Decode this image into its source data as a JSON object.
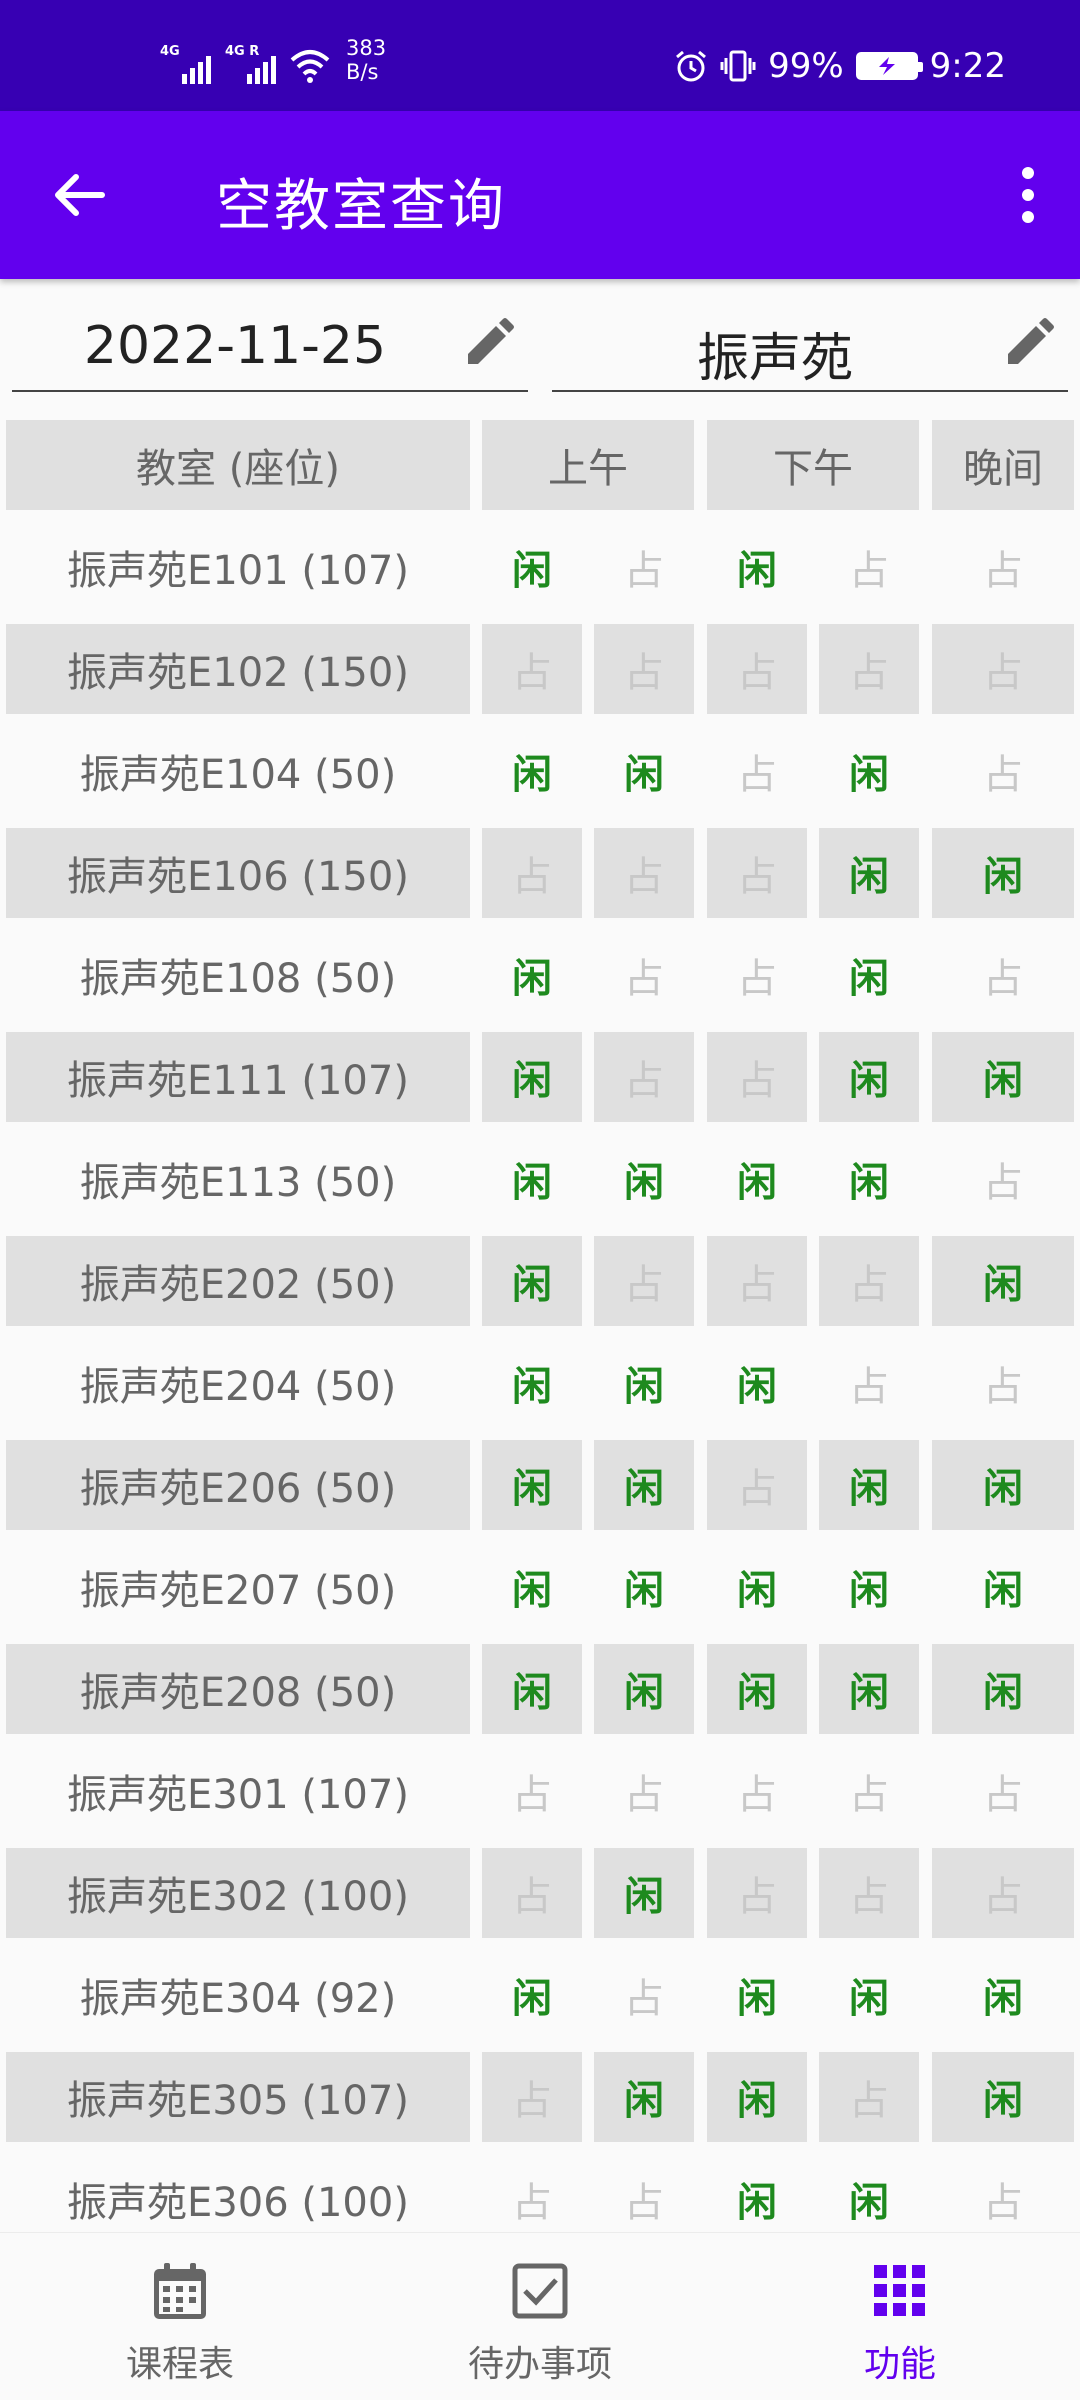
{
  "status_bar": {
    "network_1": "4G",
    "network_2": "4G R",
    "net_speed_value": "383",
    "net_speed_unit": "B/s",
    "battery_percent": "99%",
    "time": "9:22"
  },
  "app_bar": {
    "title": "空教室查询",
    "back_icon": "arrow-back-icon",
    "more_icon": "more-vert-icon"
  },
  "filters": {
    "date": "2022-11-25",
    "building": "振声苑"
  },
  "table": {
    "headers": {
      "room": "教室 (座位)",
      "morning": "上午",
      "afternoon": "下午",
      "evening": "晚间"
    },
    "free_label": "闲",
    "busy_label": "占",
    "rows": [
      {
        "name": "振声苑E101 (107)",
        "cells": [
          "闲",
          "占",
          "闲",
          "占",
          "占"
        ]
      },
      {
        "name": "振声苑E102 (150)",
        "cells": [
          "占",
          "占",
          "占",
          "占",
          "占"
        ]
      },
      {
        "name": "振声苑E104 (50)",
        "cells": [
          "闲",
          "闲",
          "占",
          "闲",
          "占"
        ]
      },
      {
        "name": "振声苑E106 (150)",
        "cells": [
          "占",
          "占",
          "占",
          "闲",
          "闲"
        ]
      },
      {
        "name": "振声苑E108 (50)",
        "cells": [
          "闲",
          "占",
          "占",
          "闲",
          "占"
        ]
      },
      {
        "name": "振声苑E111 (107)",
        "cells": [
          "闲",
          "占",
          "占",
          "闲",
          "闲"
        ]
      },
      {
        "name": "振声苑E113 (50)",
        "cells": [
          "闲",
          "闲",
          "闲",
          "闲",
          "占"
        ]
      },
      {
        "name": "振声苑E202 (50)",
        "cells": [
          "闲",
          "占",
          "占",
          "占",
          "闲"
        ]
      },
      {
        "name": "振声苑E204 (50)",
        "cells": [
          "闲",
          "闲",
          "闲",
          "占",
          "占"
        ]
      },
      {
        "name": "振声苑E206 (50)",
        "cells": [
          "闲",
          "闲",
          "占",
          "闲",
          "闲"
        ]
      },
      {
        "name": "振声苑E207 (50)",
        "cells": [
          "闲",
          "闲",
          "闲",
          "闲",
          "闲"
        ]
      },
      {
        "name": "振声苑E208 (50)",
        "cells": [
          "闲",
          "闲",
          "闲",
          "闲",
          "闲"
        ]
      },
      {
        "name": "振声苑E301 (107)",
        "cells": [
          "占",
          "占",
          "占",
          "占",
          "占"
        ]
      },
      {
        "name": "振声苑E302 (100)",
        "cells": [
          "占",
          "闲",
          "占",
          "占",
          "占"
        ]
      },
      {
        "name": "振声苑E304 (92)",
        "cells": [
          "闲",
          "占",
          "闲",
          "闲",
          "闲"
        ]
      },
      {
        "name": "振声苑E305 (107)",
        "cells": [
          "占",
          "闲",
          "闲",
          "占",
          "闲"
        ]
      },
      {
        "name": "振声苑E306 (100)",
        "cells": [
          "占",
          "占",
          "闲",
          "闲",
          "占"
        ]
      }
    ]
  },
  "bottom_nav": {
    "items": [
      {
        "label": "课程表",
        "icon": "calendar-icon"
      },
      {
        "label": "待办事项",
        "icon": "checkbox-icon"
      },
      {
        "label": "功能",
        "icon": "grid-apps-icon"
      }
    ],
    "active_index": 2
  },
  "colors": {
    "status_bar": "#3700b3",
    "app_bar": "#6200ee",
    "free": "#1e8a1e",
    "busy": "#c8c8c8",
    "active_nav": "#6200ee"
  }
}
